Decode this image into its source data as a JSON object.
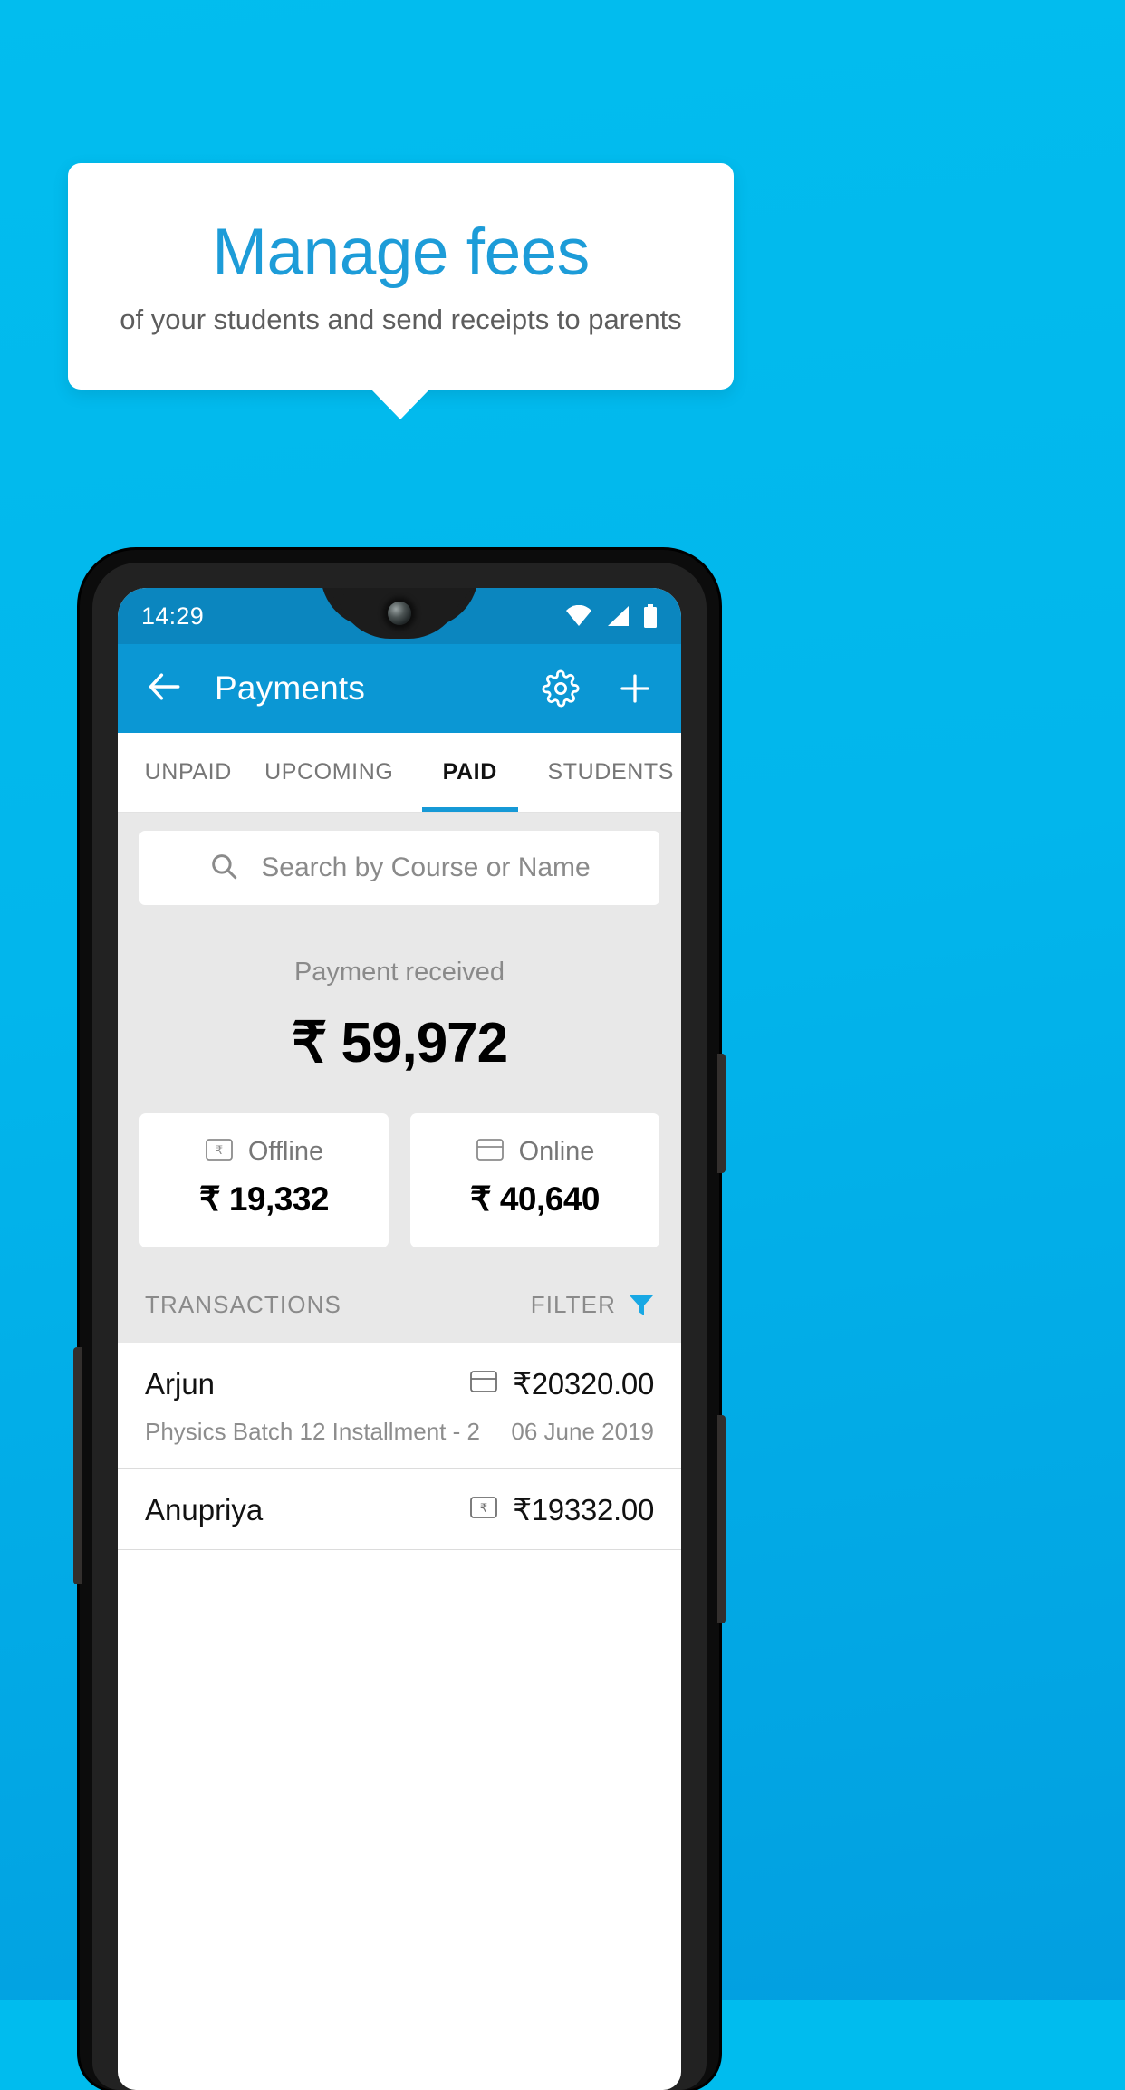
{
  "promo": {
    "title": "Manage fees",
    "subtitle": "of your students and send receipts to parents"
  },
  "colors": {
    "background": "#00bcee",
    "appbar": "#0b97d4",
    "statusbar": "#0b86bf",
    "accent": "#1699d6",
    "promo_title": "#1d9cd8",
    "body_grey": "#e8e8e8"
  },
  "phone": {
    "status_bar": {
      "time": "14:29",
      "icons": [
        "wifi-icon",
        "signal-icon",
        "battery-icon"
      ]
    },
    "app_bar": {
      "back_icon": "back-arrow-icon",
      "title": "Payments",
      "settings_icon": "gear-icon",
      "add_icon": "plus-icon"
    },
    "tabs": [
      {
        "label": "UNPAID",
        "active": false
      },
      {
        "label": "UPCOMING",
        "active": false
      },
      {
        "label": "PAID",
        "active": true
      },
      {
        "label": "STUDENTS",
        "active": false
      }
    ],
    "search": {
      "icon": "search-icon",
      "placeholder": "Search by Course or Name",
      "value": ""
    },
    "summary": {
      "label": "Payment received",
      "amount": "₹ 59,972"
    },
    "split_cards": [
      {
        "icon": "banknote-icon",
        "label": "Offline",
        "amount": "₹ 19,332"
      },
      {
        "icon": "credit-card-icon",
        "label": "Online",
        "amount": "₹ 40,640"
      }
    ],
    "transactions_header": {
      "label": "TRANSACTIONS",
      "filter_label": "FILTER",
      "filter_icon": "filter-funnel-icon"
    },
    "transactions": [
      {
        "name": "Arjun",
        "course": "Physics Batch 12 Installment - 2",
        "amount": "₹20320.00",
        "date": "06 June 2019",
        "method_icon": "credit-card-icon"
      },
      {
        "name": "Anupriya",
        "course": "",
        "amount": "₹19332.00",
        "date": "",
        "method_icon": "banknote-icon"
      }
    ]
  }
}
